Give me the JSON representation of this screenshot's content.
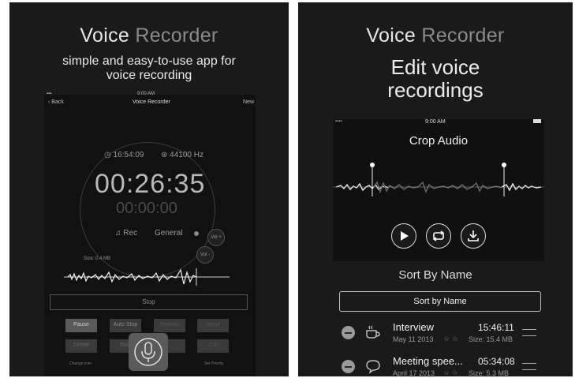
{
  "left": {
    "brand_word1": "Voice",
    "brand_word2": " Recorder",
    "tagline_line1": "simple and easy-to-use app for",
    "tagline_line2": "voice recording",
    "device": {
      "back_label": "Back",
      "title": "Voice Recorder",
      "time": "9:00 AM",
      "new_label": "New",
      "elapsed_clock": "16:54:09",
      "sample_rate": "44100 Hz",
      "main_timer": "00:26:35",
      "secondary_timer": "00:00:00",
      "rec_label": "Rec",
      "general_label": "General",
      "vol_plus": "Vol +",
      "vol_minus": "Vol -",
      "size_label": "Size: 0.4 MB",
      "stop_label": "Stop",
      "buttons_row1": [
        "Pause",
        "Auto Stop",
        "Rewrite",
        "Send"
      ],
      "buttons_row2": [
        "Delete",
        "Stop",
        "",
        "Cut"
      ],
      "footer_left": "Change icon",
      "footer_right": "Set Priority"
    }
  },
  "right": {
    "brand_word1": "Voice",
    "brand_word2": " Recorder",
    "headline_line1": "Edit voice",
    "headline_line2": "recordings",
    "phone": {
      "time": "9:00 AM",
      "title": "Crop Audio"
    },
    "sort_heading": "Sort By Name",
    "sort_button": "Sort by Name",
    "recordings": [
      {
        "name": "Interview",
        "date": "May 11 2013",
        "duration": "15:46:11",
        "size": "Size: 15.4 MB",
        "icon": "coffee-cup-icon"
      },
      {
        "name": "Meeting spee...",
        "date": "April 17 2013",
        "duration": "05:34:08",
        "size": "Size: 5.3 MB",
        "icon": "speech-bubble-icon"
      }
    ]
  },
  "colors": {
    "panel_bg": "#1a1a1a",
    "text": "#e6e6e6",
    "muted": "#8a8a8a"
  }
}
